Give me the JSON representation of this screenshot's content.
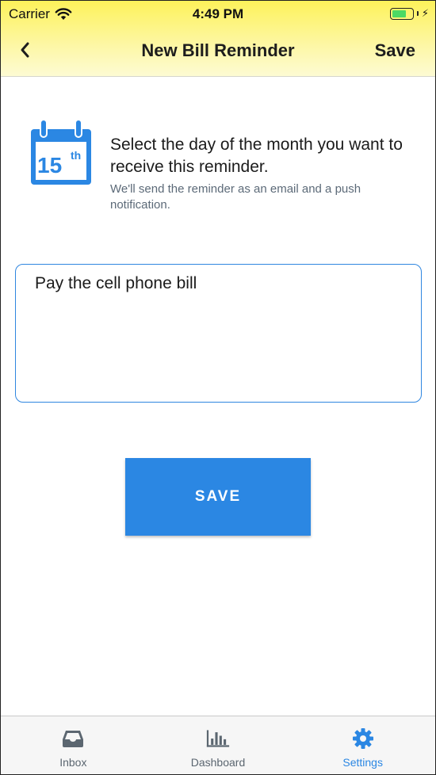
{
  "status_bar": {
    "carrier": "Carrier",
    "time": "4:49 PM",
    "battery_percent": 0.7,
    "battery_color": "#4cd964"
  },
  "navbar": {
    "back_icon": "chevron-left-icon",
    "title": "New Bill Reminder",
    "save_label": "Save"
  },
  "intro": {
    "calendar_day": "15",
    "calendar_suffix": "th",
    "main_text": "Select the day of the month you want to receive this reminder.",
    "sub_text": "We'll send the reminder as an email and a push notification."
  },
  "note": {
    "value": "Pay the cell phone bill"
  },
  "save_button": {
    "label": "SAVE"
  },
  "tabbar": {
    "tabs": [
      {
        "label": "Inbox",
        "icon": "inbox-tray-icon",
        "active": false
      },
      {
        "label": "Dashboard",
        "icon": "bar-chart-icon",
        "active": false
      },
      {
        "label": "Settings",
        "icon": "gear-icon",
        "active": true
      }
    ]
  },
  "colors": {
    "accent": "#2b87e3",
    "header_gradient_top": "#fdf25a",
    "header_gradient_bottom": "#fdfbd3"
  }
}
